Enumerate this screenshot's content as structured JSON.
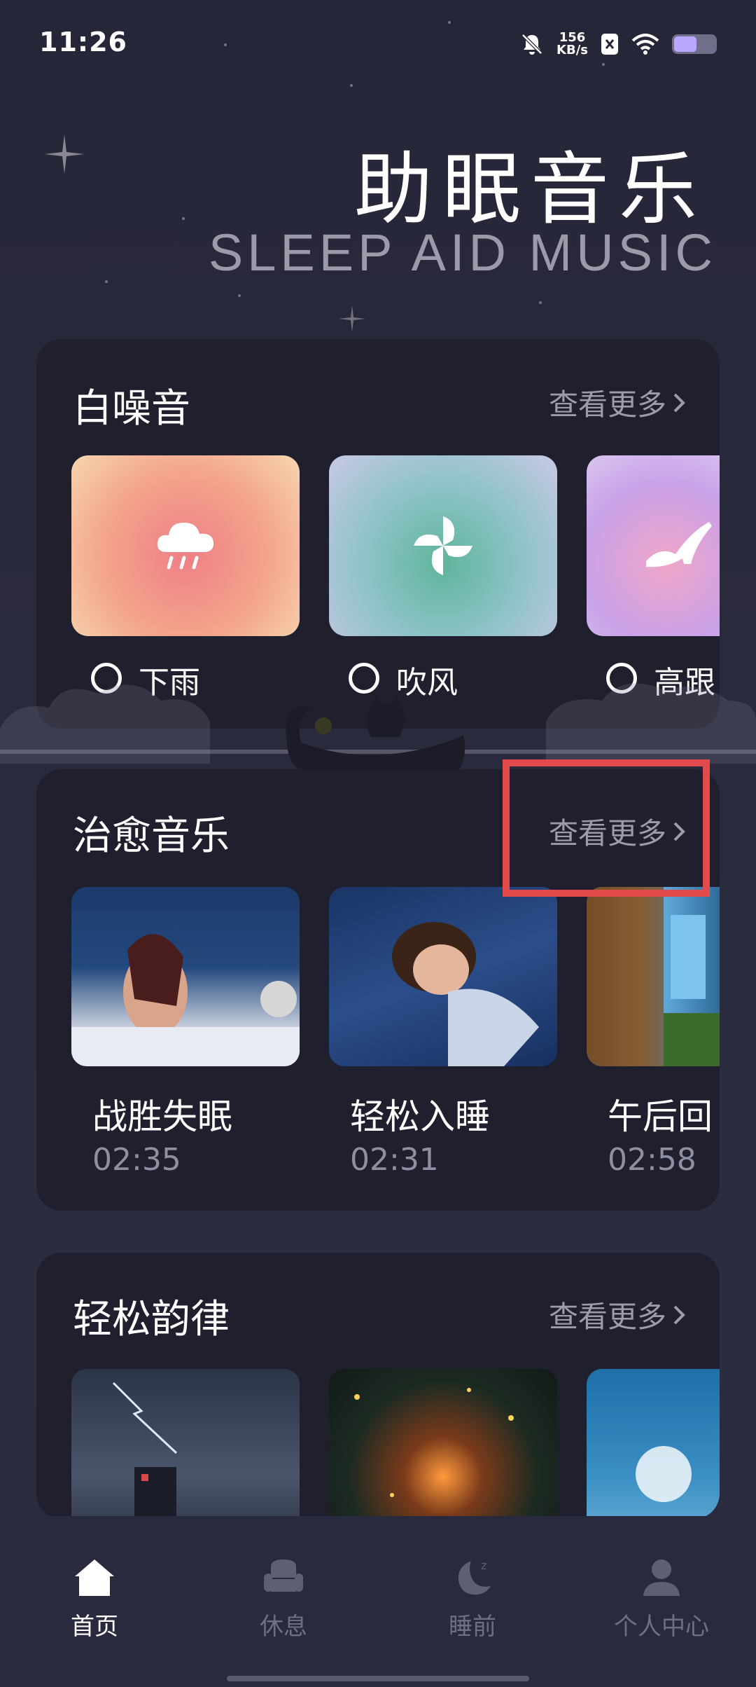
{
  "status_bar": {
    "time": "11:26",
    "network_speed": "156",
    "network_unit": "KB/s",
    "battery_level": 0.55
  },
  "header": {
    "title": "助眠音乐",
    "subtitle": "SLEEP AID MUSIC"
  },
  "white_noise": {
    "title": "白噪音",
    "more_label": "查看更多",
    "items": [
      {
        "label": "下雨",
        "icon": "rain-cloud-icon"
      },
      {
        "label": "吹风",
        "icon": "wind-pinwheel-icon"
      },
      {
        "label": "高跟",
        "icon": "high-heel-icon"
      }
    ]
  },
  "healing_music": {
    "title": "治愈音乐",
    "more_label": "查看更多",
    "items": [
      {
        "title": "战胜失眠",
        "duration": "02:35"
      },
      {
        "title": "轻松入睡",
        "duration": "02:31"
      },
      {
        "title": "午后回",
        "duration": "02:58"
      }
    ]
  },
  "relaxing_rhythm": {
    "title": "轻松韵律",
    "more_label": "查看更多"
  },
  "bottom_nav": {
    "items": [
      {
        "label": "首页",
        "icon": "home-icon",
        "active": true
      },
      {
        "label": "休息",
        "icon": "armchair-icon",
        "active": false
      },
      {
        "label": "睡前",
        "icon": "moon-icon",
        "active": false
      },
      {
        "label": "个人中心",
        "icon": "person-icon",
        "active": false
      }
    ]
  },
  "colors": {
    "background": "#282839",
    "card": "#1f1f2e",
    "highlight": "#e14b4b",
    "muted_text": "#9b9bac"
  }
}
